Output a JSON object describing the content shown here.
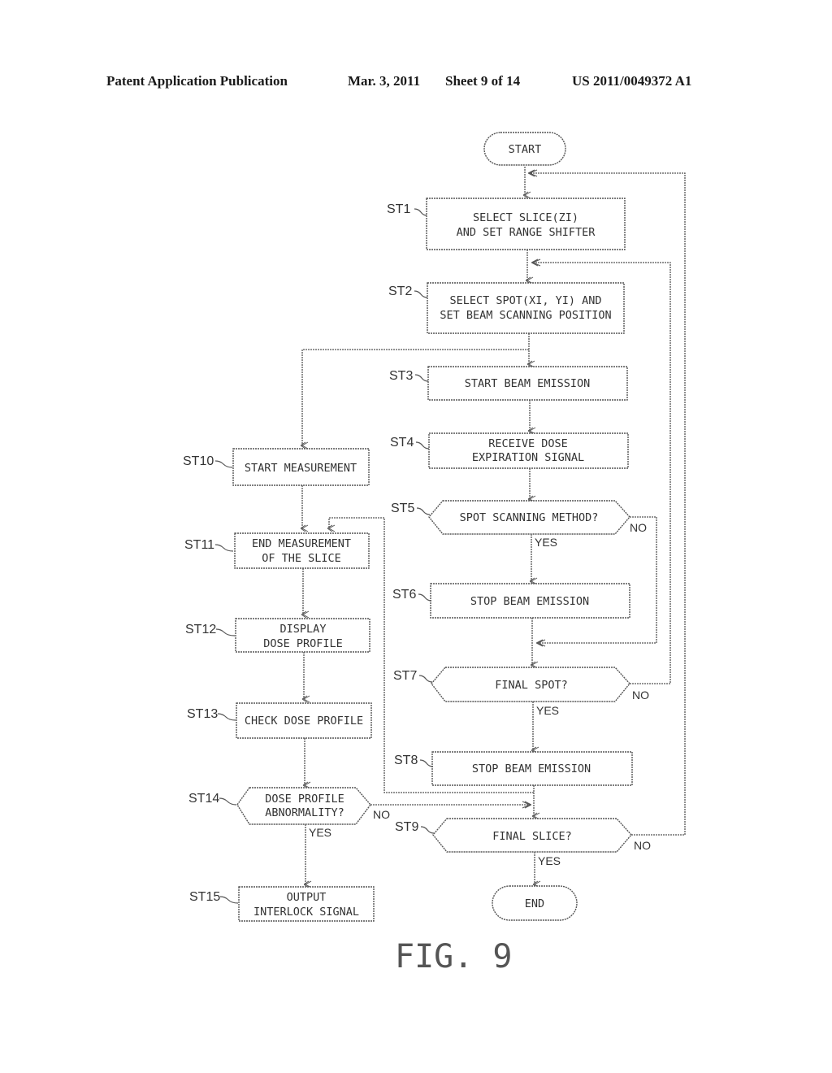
{
  "header": {
    "publication": "Patent Application Publication",
    "date": "Mar. 3, 2011",
    "sheet": "Sheet 9 of 14",
    "number": "US 2011/0049372 A1"
  },
  "figure": {
    "label": "FIG. 9",
    "start": "START",
    "end": "END",
    "yes": "YES",
    "no": "NO",
    "steps": {
      "st1": {
        "id": "ST1",
        "lines": [
          "SELECT SLICE(ZI)",
          "AND SET RANGE SHIFTER"
        ]
      },
      "st2": {
        "id": "ST2",
        "lines": [
          "SELECT SPOT(XI, YI) AND",
          "SET BEAM SCANNING POSITION"
        ]
      },
      "st3": {
        "id": "ST3",
        "lines": [
          "START BEAM EMISSION"
        ]
      },
      "st4": {
        "id": "ST4",
        "lines": [
          "RECEIVE DOSE",
          "EXPIRATION SIGNAL"
        ]
      },
      "st5": {
        "id": "ST5",
        "lines": [
          "SPOT SCANNING METHOD?"
        ]
      },
      "st6": {
        "id": "ST6",
        "lines": [
          "STOP BEAM EMISSION"
        ]
      },
      "st7": {
        "id": "ST7",
        "lines": [
          "FINAL SPOT?"
        ]
      },
      "st8": {
        "id": "ST8",
        "lines": [
          "STOP BEAM EMISSION"
        ]
      },
      "st9": {
        "id": "ST9",
        "lines": [
          "FINAL SLICE?"
        ]
      },
      "st10": {
        "id": "ST10",
        "lines": [
          "START MEASUREMENT"
        ]
      },
      "st11": {
        "id": "ST11",
        "lines": [
          "END MEASUREMENT",
          "OF THE SLICE"
        ]
      },
      "st12": {
        "id": "ST12",
        "lines": [
          "DISPLAY",
          "DOSE PROFILE"
        ]
      },
      "st13": {
        "id": "ST13",
        "lines": [
          "CHECK DOSE PROFILE"
        ]
      },
      "st14": {
        "id": "ST14",
        "lines": [
          "DOSE PROFILE",
          "ABNORMALITY?"
        ]
      },
      "st15": {
        "id": "ST15",
        "lines": [
          "OUTPUT",
          "INTERLOCK SIGNAL"
        ]
      }
    }
  }
}
